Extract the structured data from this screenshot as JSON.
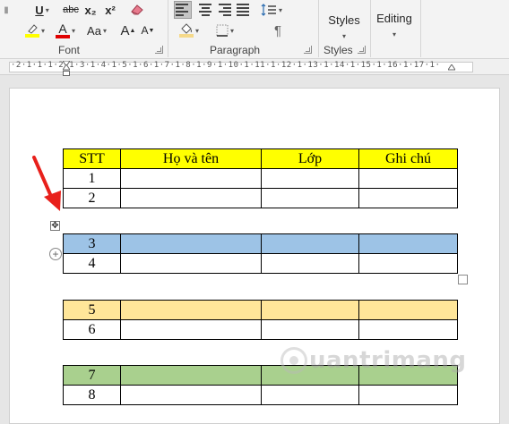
{
  "ribbon": {
    "font_group": {
      "label": "Font",
      "underline": "U",
      "strikethrough": "abc",
      "subscript": "x₂",
      "superscript": "x²",
      "font_color_letter": "A",
      "change_case": "Aa",
      "grow_font": "A",
      "shrink_font": "A"
    },
    "paragraph_group": {
      "label": "Paragraph",
      "show_marks": "¶"
    },
    "styles_group": {
      "label": "Styles",
      "button": "Styles"
    },
    "editing": {
      "button": "Editing"
    },
    "colors": {
      "highlight": "#ffff00",
      "font_color": "#e00000",
      "shading": "#f5d98a"
    }
  },
  "ruler": {
    "marks": "·2·1·1·1·2·1·3·1·4·1·5·1·6·1·7·1·8·1·9·1·10·1·11·1·12·1·13·1·14·1·15·1·16·1·17·1·"
  },
  "document": {
    "table_header": {
      "stt": "STT",
      "name": "Họ và tên",
      "class": "Lớp",
      "note": "Ghi chú"
    },
    "table1_rows": [
      {
        "stt": "1"
      },
      {
        "stt": "2"
      }
    ],
    "table2_rows": [
      {
        "stt": "3"
      },
      {
        "stt": "4"
      }
    ],
    "table3_rows": [
      {
        "stt": "5"
      },
      {
        "stt": "6"
      }
    ],
    "table4_rows": [
      {
        "stt": "7"
      },
      {
        "stt": "8"
      }
    ],
    "row_colors": {
      "header": "#ffff00",
      "selected_blue": "#9dc3e6",
      "orange": "#ffe699",
      "green": "#a9d08e"
    }
  },
  "watermark": {
    "text": "uantrimang"
  }
}
